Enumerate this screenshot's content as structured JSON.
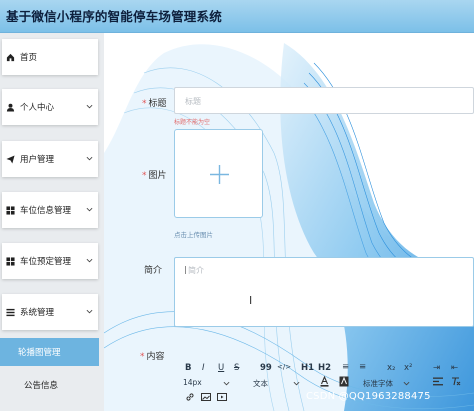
{
  "header": {
    "title": "基于微信小程序的智能停车场管理系统"
  },
  "sidebar": {
    "items": [
      {
        "label": "首页",
        "icon": "home-icon"
      },
      {
        "label": "个人中心",
        "icon": "user-icon"
      },
      {
        "label": "用户管理",
        "icon": "send-icon"
      },
      {
        "label": "车位信息管理",
        "icon": "grid-icon"
      },
      {
        "label": "车位预定管理",
        "icon": "grid-icon"
      },
      {
        "label": "系统管理",
        "icon": "list-icon"
      }
    ],
    "sub_items": [
      {
        "label": "轮播图管理",
        "active": true
      },
      {
        "label": "公告信息",
        "active": false
      }
    ]
  },
  "form": {
    "title_label": "标题",
    "title_placeholder": "标题",
    "title_hint": "标题不能为空",
    "image_label": "图片",
    "upload_hint": "点击上传图片",
    "intro_label": "简介",
    "intro_placeholder": "简介",
    "content_label": "内容"
  },
  "editor": {
    "row1": [
      "B",
      "I",
      "U",
      "S",
      "99",
      "</>",
      "H1",
      "H2",
      "≡",
      "≡",
      "x₂",
      "x²",
      "⇥",
      "⇤"
    ],
    "font_size": "14px",
    "text_style": "文本",
    "font_family": "标准字体"
  },
  "watermark": "CSDN @QQ1963288475",
  "colors": {
    "accent": "#6db4e0",
    "header_bg": "#8ccaee",
    "required": "#e05656"
  }
}
